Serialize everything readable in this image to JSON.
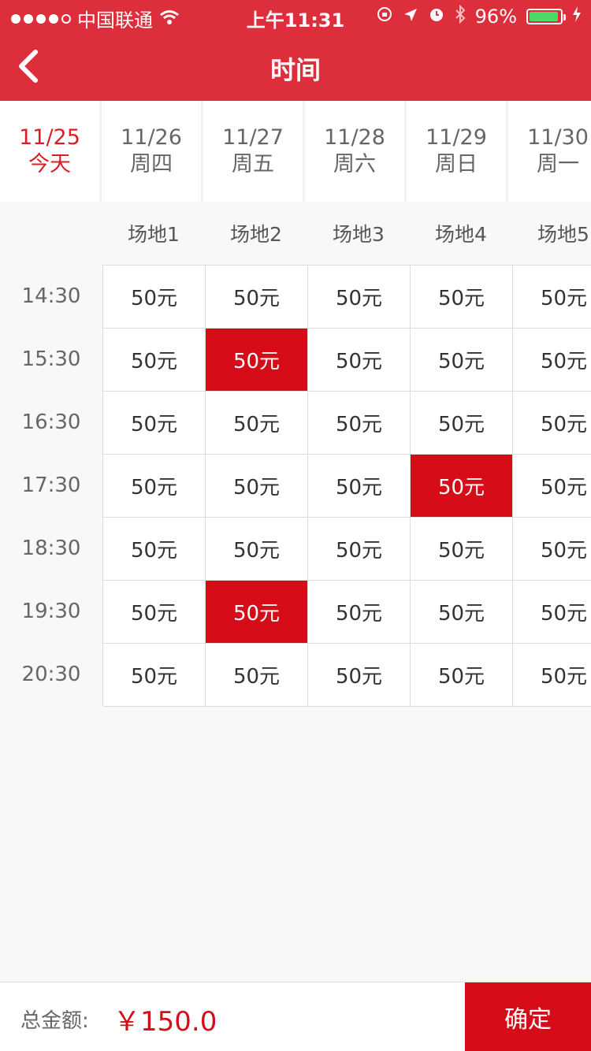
{
  "status_bar": {
    "carrier": "中国联通",
    "time": "上午11:31",
    "battery_text": "96%",
    "battery_level": 0.96
  },
  "nav": {
    "title": "时间"
  },
  "dates": [
    {
      "date": "11/25",
      "weekday": "今天",
      "active": true
    },
    {
      "date": "11/26",
      "weekday": "周四",
      "active": false
    },
    {
      "date": "11/27",
      "weekday": "周五",
      "active": false
    },
    {
      "date": "11/28",
      "weekday": "周六",
      "active": false
    },
    {
      "date": "11/29",
      "weekday": "周日",
      "active": false
    },
    {
      "date": "11/30",
      "weekday": "周一",
      "active": false
    }
  ],
  "venues": [
    "场地1",
    "场地2",
    "场地3",
    "场地4",
    "场地5"
  ],
  "times": [
    "14:30",
    "15:30",
    "16:30",
    "17:30",
    "18:30",
    "19:30",
    "20:30"
  ],
  "price_label": "50元",
  "selected": [
    [
      1,
      1
    ],
    [
      3,
      3
    ],
    [
      5,
      1
    ]
  ],
  "footer": {
    "total_label": "总金额:",
    "total_value": "￥150.0",
    "confirm_label": "确定"
  },
  "colors": {
    "header_red": "#dc2f3b",
    "accent_red": "#d60d18",
    "battery_green": "#4cd964"
  },
  "icons": [
    "wifi-icon",
    "orientation-lock-icon",
    "location-arrow-icon",
    "alarm-icon",
    "bluetooth-icon",
    "battery-icon",
    "charging-bolt-icon",
    "back-chevron-icon"
  ]
}
